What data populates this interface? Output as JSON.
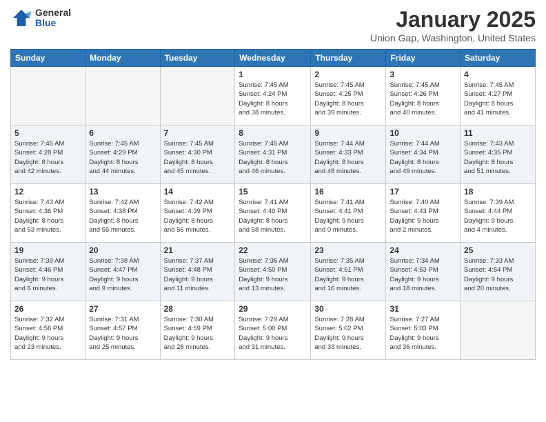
{
  "header": {
    "logo": {
      "general": "General",
      "blue": "Blue"
    },
    "title": "January 2025",
    "location": "Union Gap, Washington, United States"
  },
  "weekdays": [
    "Sunday",
    "Monday",
    "Tuesday",
    "Wednesday",
    "Thursday",
    "Friday",
    "Saturday"
  ],
  "weeks": [
    [
      {
        "day": "",
        "info": ""
      },
      {
        "day": "",
        "info": ""
      },
      {
        "day": "",
        "info": ""
      },
      {
        "day": "1",
        "info": "Sunrise: 7:45 AM\nSunset: 4:24 PM\nDaylight: 8 hours\nand 38 minutes."
      },
      {
        "day": "2",
        "info": "Sunrise: 7:45 AM\nSunset: 4:25 PM\nDaylight: 8 hours\nand 39 minutes."
      },
      {
        "day": "3",
        "info": "Sunrise: 7:45 AM\nSunset: 4:26 PM\nDaylight: 8 hours\nand 40 minutes."
      },
      {
        "day": "4",
        "info": "Sunrise: 7:45 AM\nSunset: 4:27 PM\nDaylight: 8 hours\nand 41 minutes."
      }
    ],
    [
      {
        "day": "5",
        "info": "Sunrise: 7:45 AM\nSunset: 4:28 PM\nDaylight: 8 hours\nand 42 minutes."
      },
      {
        "day": "6",
        "info": "Sunrise: 7:45 AM\nSunset: 4:29 PM\nDaylight: 8 hours\nand 44 minutes."
      },
      {
        "day": "7",
        "info": "Sunrise: 7:45 AM\nSunset: 4:30 PM\nDaylight: 8 hours\nand 45 minutes."
      },
      {
        "day": "8",
        "info": "Sunrise: 7:45 AM\nSunset: 4:31 PM\nDaylight: 8 hours\nand 46 minutes."
      },
      {
        "day": "9",
        "info": "Sunrise: 7:44 AM\nSunset: 4:33 PM\nDaylight: 8 hours\nand 48 minutes."
      },
      {
        "day": "10",
        "info": "Sunrise: 7:44 AM\nSunset: 4:34 PM\nDaylight: 8 hours\nand 49 minutes."
      },
      {
        "day": "11",
        "info": "Sunrise: 7:43 AM\nSunset: 4:35 PM\nDaylight: 8 hours\nand 51 minutes."
      }
    ],
    [
      {
        "day": "12",
        "info": "Sunrise: 7:43 AM\nSunset: 4:36 PM\nDaylight: 8 hours\nand 53 minutes."
      },
      {
        "day": "13",
        "info": "Sunrise: 7:42 AM\nSunset: 4:38 PM\nDaylight: 8 hours\nand 55 minutes."
      },
      {
        "day": "14",
        "info": "Sunrise: 7:42 AM\nSunset: 4:39 PM\nDaylight: 8 hours\nand 56 minutes."
      },
      {
        "day": "15",
        "info": "Sunrise: 7:41 AM\nSunset: 4:40 PM\nDaylight: 8 hours\nand 58 minutes."
      },
      {
        "day": "16",
        "info": "Sunrise: 7:41 AM\nSunset: 4:41 PM\nDaylight: 9 hours\nand 0 minutes."
      },
      {
        "day": "17",
        "info": "Sunrise: 7:40 AM\nSunset: 4:43 PM\nDaylight: 9 hours\nand 2 minutes."
      },
      {
        "day": "18",
        "info": "Sunrise: 7:39 AM\nSunset: 4:44 PM\nDaylight: 9 hours\nand 4 minutes."
      }
    ],
    [
      {
        "day": "19",
        "info": "Sunrise: 7:39 AM\nSunset: 4:46 PM\nDaylight: 9 hours\nand 6 minutes."
      },
      {
        "day": "20",
        "info": "Sunrise: 7:38 AM\nSunset: 4:47 PM\nDaylight: 9 hours\nand 9 minutes."
      },
      {
        "day": "21",
        "info": "Sunrise: 7:37 AM\nSunset: 4:48 PM\nDaylight: 9 hours\nand 11 minutes."
      },
      {
        "day": "22",
        "info": "Sunrise: 7:36 AM\nSunset: 4:50 PM\nDaylight: 9 hours\nand 13 minutes."
      },
      {
        "day": "23",
        "info": "Sunrise: 7:35 AM\nSunset: 4:51 PM\nDaylight: 9 hours\nand 16 minutes."
      },
      {
        "day": "24",
        "info": "Sunrise: 7:34 AM\nSunset: 4:53 PM\nDaylight: 9 hours\nand 18 minutes."
      },
      {
        "day": "25",
        "info": "Sunrise: 7:33 AM\nSunset: 4:54 PM\nDaylight: 9 hours\nand 20 minutes."
      }
    ],
    [
      {
        "day": "26",
        "info": "Sunrise: 7:32 AM\nSunset: 4:56 PM\nDaylight: 9 hours\nand 23 minutes."
      },
      {
        "day": "27",
        "info": "Sunrise: 7:31 AM\nSunset: 4:57 PM\nDaylight: 9 hours\nand 25 minutes."
      },
      {
        "day": "28",
        "info": "Sunrise: 7:30 AM\nSunset: 4:59 PM\nDaylight: 9 hours\nand 28 minutes."
      },
      {
        "day": "29",
        "info": "Sunrise: 7:29 AM\nSunset: 5:00 PM\nDaylight: 9 hours\nand 31 minutes."
      },
      {
        "day": "30",
        "info": "Sunrise: 7:28 AM\nSunset: 5:02 PM\nDaylight: 9 hours\nand 33 minutes."
      },
      {
        "day": "31",
        "info": "Sunrise: 7:27 AM\nSunset: 5:03 PM\nDaylight: 9 hours\nand 36 minutes."
      },
      {
        "day": "",
        "info": ""
      }
    ]
  ]
}
